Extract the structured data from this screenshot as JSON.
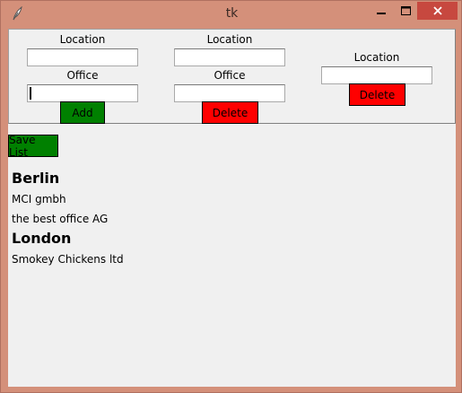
{
  "window": {
    "title": "tk"
  },
  "add_form": {
    "location_label": "Location",
    "location_value": "",
    "office_label": "Office",
    "office_value": "",
    "add_label": "Add"
  },
  "delete_office_form": {
    "location_label": "Location",
    "location_value": "",
    "office_label": "Office",
    "office_value": "",
    "delete_label": "Delete"
  },
  "delete_location_form": {
    "location_label": "Location",
    "location_value": "",
    "delete_label": "Delete"
  },
  "save_label": "Save List",
  "list": {
    "locations": [
      {
        "name": "Berlin",
        "offices": [
          "MCI gmbh",
          "the best office AG"
        ]
      },
      {
        "name": "London",
        "offices": [
          "Smokey Chickens ltd"
        ]
      }
    ]
  },
  "colors": {
    "add_button": "#008000",
    "delete_button": "#ff0000",
    "save_button": "#008000",
    "window_border": "#d4907a",
    "close_button": "#c7483f"
  }
}
